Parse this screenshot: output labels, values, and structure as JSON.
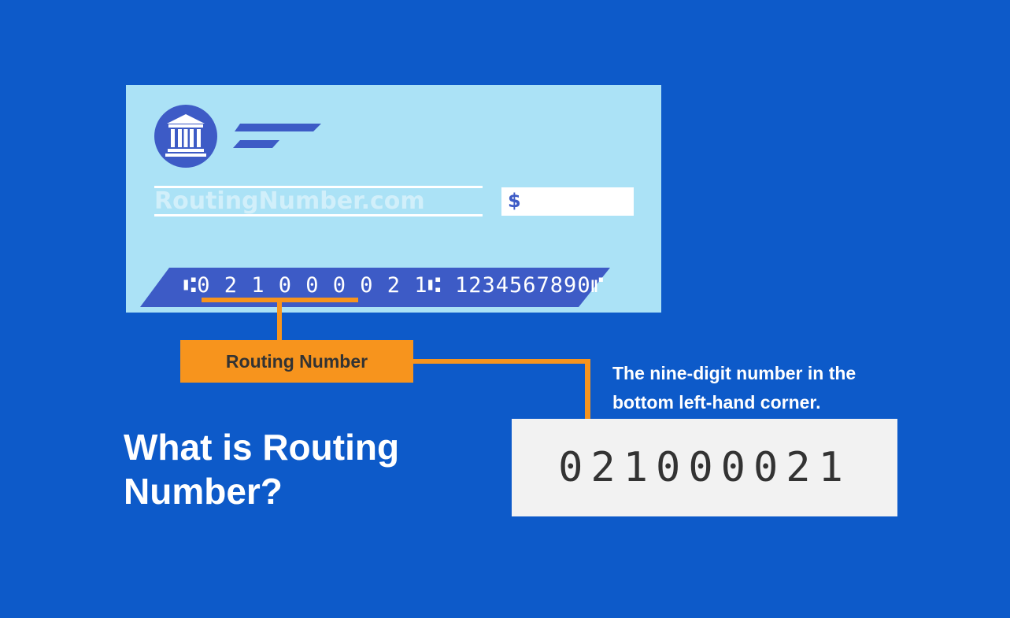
{
  "check": {
    "watermark": "RoutingNumber.com",
    "dollar_sign": "$",
    "micr_prefix": "⑆",
    "micr_routing": "0 2 1 0 0 0 0 2 1",
    "micr_separator": "⑆ ",
    "micr_account": "1234567890",
    "micr_suffix": "⑈",
    "bank_icon": "bank-building-icon"
  },
  "callout": {
    "label": "Routing Number",
    "description_line1": "The nine-digit number in the",
    "description_line2": "bottom left-hand corner.",
    "digits": "021000021"
  },
  "title": {
    "line1": "What is Routing",
    "line2": "Number?"
  },
  "colors": {
    "background": "#0d5ac9",
    "check": "#abe2f6",
    "accent_blue": "#3d5bc6",
    "orange": "#f7941d"
  }
}
